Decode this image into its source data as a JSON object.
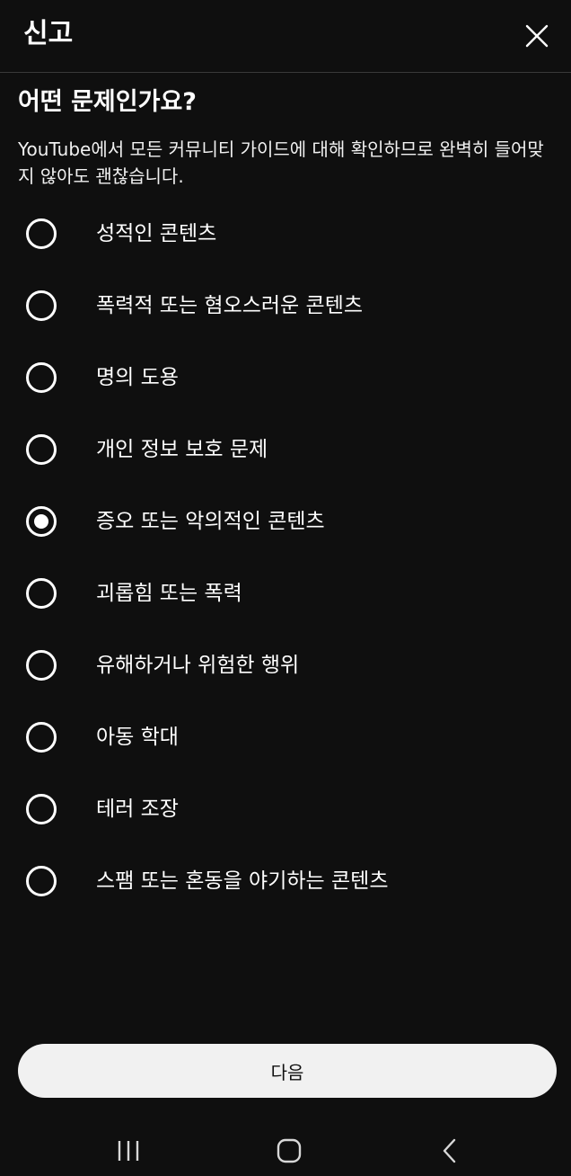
{
  "header": {
    "title": "신고"
  },
  "question": "어떤 문제인가요?",
  "description": "YouTube에서 모든 커뮤니티 가이드에 대해 확인하므로 완벽히 들어맞지 않아도 괜찮습니다.",
  "options": [
    {
      "label": "성적인 콘텐츠",
      "selected": false
    },
    {
      "label": "폭력적 또는 혐오스러운 콘텐츠",
      "selected": false
    },
    {
      "label": "명의 도용",
      "selected": false
    },
    {
      "label": "개인 정보 보호 문제",
      "selected": false
    },
    {
      "label": "증오 또는 악의적인 콘텐츠",
      "selected": true
    },
    {
      "label": "괴롭힘 또는 폭력",
      "selected": false
    },
    {
      "label": "유해하거나 위험한 행위",
      "selected": false
    },
    {
      "label": "아동 학대",
      "selected": false
    },
    {
      "label": "테러 조장",
      "selected": false
    },
    {
      "label": "스팸 또는 혼동을 야기하는 콘텐츠",
      "selected": false
    }
  ],
  "next_button": {
    "label": "다음"
  },
  "system_nav": {
    "icons": [
      "recent-apps-icon",
      "home-icon",
      "back-icon"
    ]
  },
  "colors": {
    "background": "#0f0f0f",
    "text": "#ffffff",
    "button_background": "#f1f1f1"
  }
}
